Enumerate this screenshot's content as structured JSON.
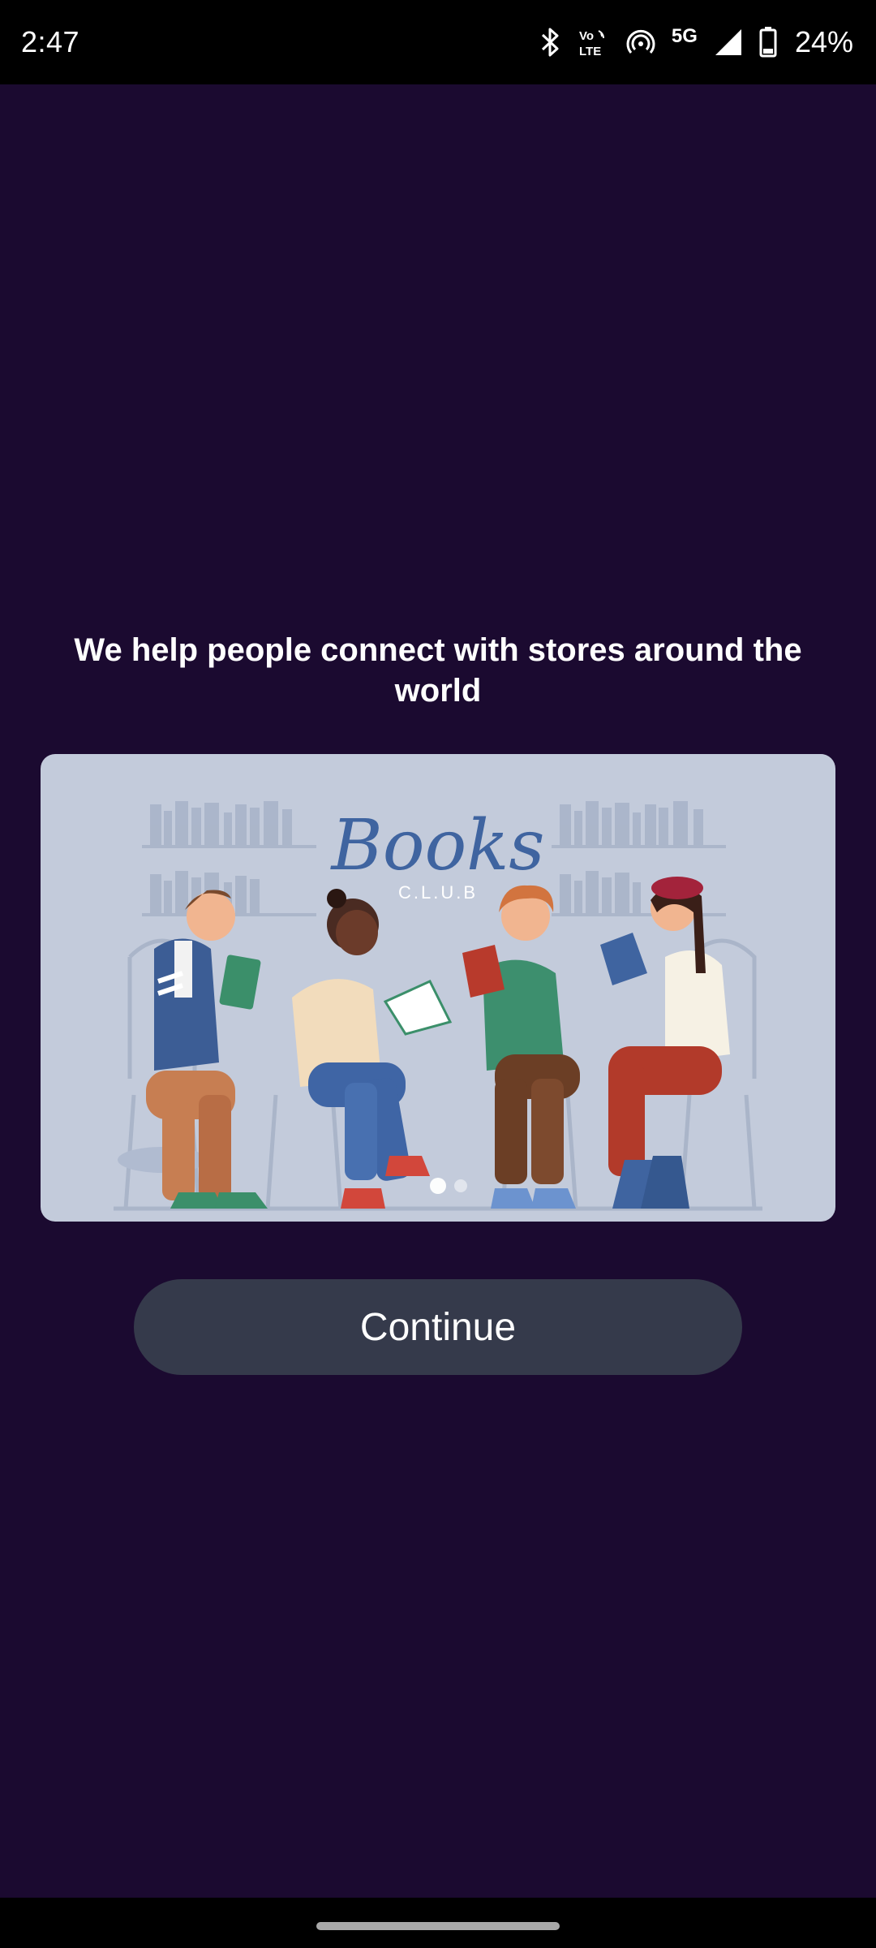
{
  "status_bar": {
    "time": "2:47",
    "battery_percent": "24%",
    "network_label": "5G",
    "volte_label_top": "Vo",
    "volte_label_bottom": "LTE",
    "icons": [
      "bluetooth-icon",
      "volte-icon",
      "hotspot-icon",
      "signal-icon",
      "battery-icon"
    ]
  },
  "onboarding": {
    "headline": "We help people connect with stores around the world",
    "hero_image": {
      "logo_title": "Books",
      "logo_subtitle": "C.L.U.B"
    },
    "continue_label": "Continue"
  },
  "colors": {
    "background": "#1b0a30",
    "button": "#353a4b",
    "card": "#c3cbdb"
  }
}
